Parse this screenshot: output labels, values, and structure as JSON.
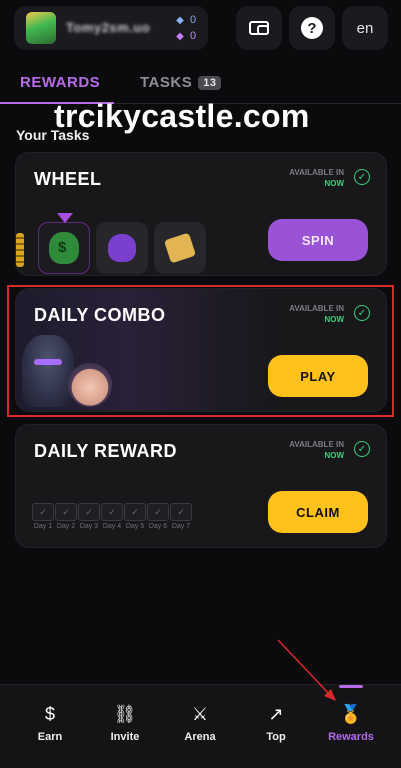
{
  "header": {
    "username": "Tomy2sm.uo",
    "currency_blue": "0",
    "currency_purple": "0",
    "lang": "en",
    "help_glyph": "?"
  },
  "tabs": {
    "rewards": "REWARDS",
    "tasks": "TASKS",
    "tasks_count": "13"
  },
  "watermark": "trcikycastle.com",
  "section_title": "Your Tasks",
  "cards": {
    "wheel": {
      "title": "WHEEL",
      "available_label": "AVAILABLE IN",
      "available_value": "NOW",
      "button": "SPIN"
    },
    "combo": {
      "title": "DAILY COMBO",
      "available_label": "AVAILABLE IN",
      "available_value": "NOW",
      "button": "PLAY"
    },
    "reward": {
      "title": "DAILY REWARD",
      "available_label": "AVAILABLE IN",
      "available_value": "NOW",
      "button": "CLAIM",
      "days": [
        "Day 1",
        "Day 2",
        "Day 3",
        "Day 4",
        "Day 5",
        "Day 6",
        "Day 7"
      ]
    }
  },
  "nav": {
    "earn": "Earn",
    "invite": "Invite",
    "arena": "Arena",
    "top": "Top",
    "rewards": "Rewards"
  },
  "colors": {
    "accent": "#b76be8",
    "yellow": "#ffc11a",
    "green": "#36d07a",
    "frame": "#d92a2a"
  }
}
